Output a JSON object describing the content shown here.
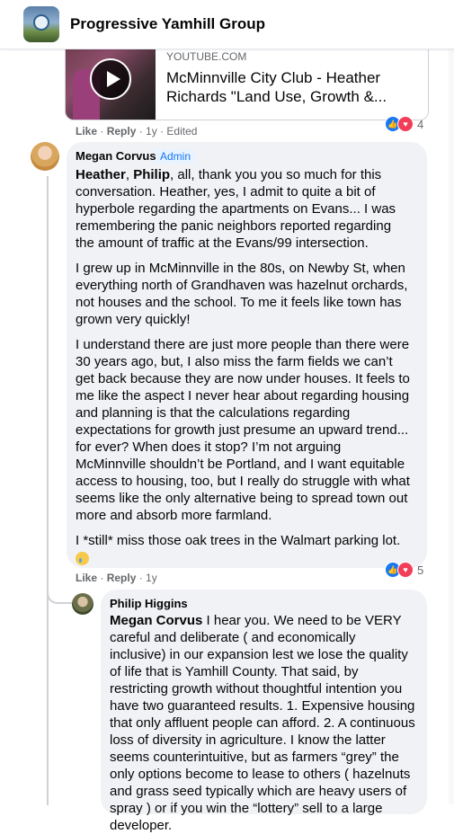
{
  "header": {
    "group_name": "Progressive Yamhill Group"
  },
  "link_card": {
    "source": "YOUTUBE.COM",
    "title": "McMinnville City Club - Heather Richards \"Land Use, Growth &..."
  },
  "comment1_meta": {
    "like": "Like",
    "sep1": " · ",
    "reply": "Reply",
    "sep2": " · ",
    "time": "1y",
    "sep3": " · ",
    "edited": "Edited",
    "reaction_count": "4"
  },
  "comment2": {
    "author": "Megan Corvus",
    "badge": "Admin",
    "p1_mention1": "Heather",
    "p1_mention2": "Philip",
    "p1_rest": ", all, thank you you so much for this conversation. Heather, yes, I admit to quite a bit of hyperbole regarding the apartments on Evans... I was remembering the panic neighbors reported regarding the amount of traffic at the Evans/99 intersection.",
    "p2": "I grew up in McMinnville in the 80s, on Newby St, when everything north of Grandhaven was hazelnut orchards, not houses and the school. To me it feels like town has grown very quickly!",
    "p3": "I understand there are just more people than there were 30 years ago, but, I also miss the farm fields we can’t get back because they are now under houses. It feels to me like the aspect I never hear about regarding housing and planning is that the calculations regarding expectations for growth just presume an upward trend... for ever? When does it stop? I’m not arguing McMinnville shouldn’t be Portland, and I want equitable access to housing, too, but I really do struggle with what seems like the only alternative being to spread town out more and absorb more farmland.",
    "p4": "I *still* miss those oak trees in the Walmart parking lot.",
    "emoji_name": "crying-face-emoji",
    "like": "Like",
    "sep1": " · ",
    "reply": "Reply",
    "sep2": " · ",
    "time": "1y",
    "reaction_count": "5"
  },
  "comment3": {
    "author": "Philip Higgins",
    "mention": "Megan Corvus",
    "text": " I hear you. We need to be VERY careful and deliberate ( and economically inclusive) in our expansion lest we lose the quality of life that is Yamhill County. That said, by restricting growth without thoughtful intention you have two guaranteed results. 1. Expensive housing that only affluent people can afford. 2. A continuous loss of diversity in agriculture. I know the latter seems counterintuitive, but as farmers “grey” the only options become to lease to others ( hazelnuts and grass seed typically which are heavy users of spray ) or if you win the “lottery” sell to a large developer."
  },
  "icons": {
    "like": "thumbs-up-icon",
    "love": "heart-icon",
    "play": "play-icon"
  },
  "colors": {
    "accent": "#1877f2",
    "love": "#f33e58",
    "bubble": "#f0f2f5",
    "meta": "#65676b"
  }
}
